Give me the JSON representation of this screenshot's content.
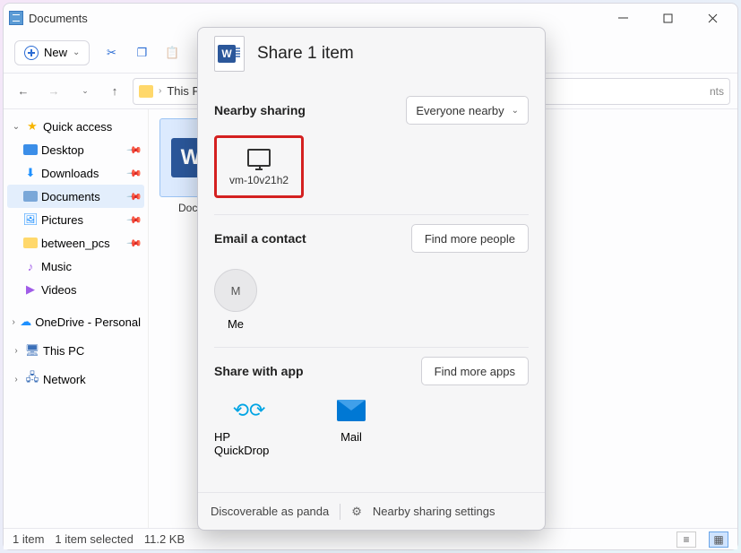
{
  "titlebar": {
    "title": "Documents"
  },
  "toolbar": {
    "new_label": "New"
  },
  "nav": {
    "breadcrumb": [
      "This PC"
    ],
    "address_suffix": "nts"
  },
  "sidebar": {
    "quick_access": "Quick access",
    "items": [
      {
        "label": "Desktop"
      },
      {
        "label": "Downloads"
      },
      {
        "label": "Documents"
      },
      {
        "label": "Pictures"
      },
      {
        "label": "between_pcs"
      },
      {
        "label": "Music"
      },
      {
        "label": "Videos"
      }
    ],
    "onedrive": "OneDrive - Personal",
    "this_pc": "This PC",
    "network": "Network"
  },
  "content": {
    "file_name": "Docum"
  },
  "status": {
    "count": "1 item",
    "selected": "1 item selected",
    "size": "11.2 KB"
  },
  "share": {
    "title": "Share 1 item",
    "nearby": {
      "title": "Nearby sharing",
      "dropdown": "Everyone nearby",
      "device": "vm-10v21h2"
    },
    "email": {
      "title": "Email a contact",
      "button": "Find more people",
      "me": "Me",
      "initial": "M"
    },
    "apps": {
      "title": "Share with app",
      "button": "Find more apps",
      "list": [
        {
          "label": "HP QuickDrop"
        },
        {
          "label": "Mail"
        }
      ]
    },
    "footer": {
      "discoverable": "Discoverable as panda",
      "settings": "Nearby sharing settings"
    }
  }
}
